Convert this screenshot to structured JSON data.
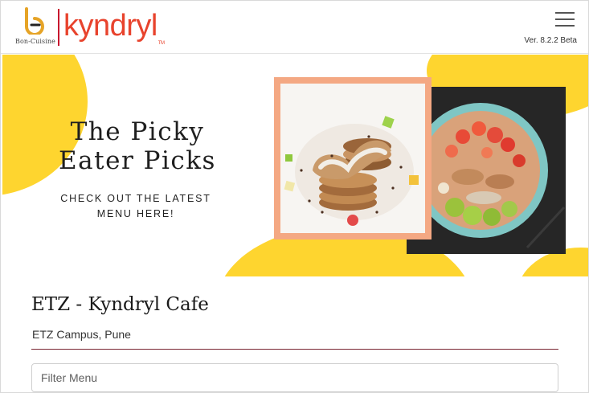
{
  "header": {
    "brand_small": "Bon-Cuisine",
    "brand_main": "kyndryl",
    "trademark": "TM",
    "version": "Ver. 8.2.2 Beta",
    "menu_icon": "hamburger-menu-icon"
  },
  "banner": {
    "title_line1": "The Picky",
    "title_line2": "Eater Picks",
    "subtitle_line1": "CHECK OUT THE LATEST",
    "subtitle_line2": "MENU HERE!"
  },
  "cafe": {
    "name": "ETZ - Kyndryl Cafe",
    "location": "ETZ Campus, Pune"
  },
  "filter": {
    "placeholder": "Filter Menu",
    "value": ""
  },
  "colors": {
    "brand_red": "#e8432d",
    "banner_yellow": "#fed52f",
    "frame_peach": "#f4a883",
    "divider": "#7a2632"
  }
}
